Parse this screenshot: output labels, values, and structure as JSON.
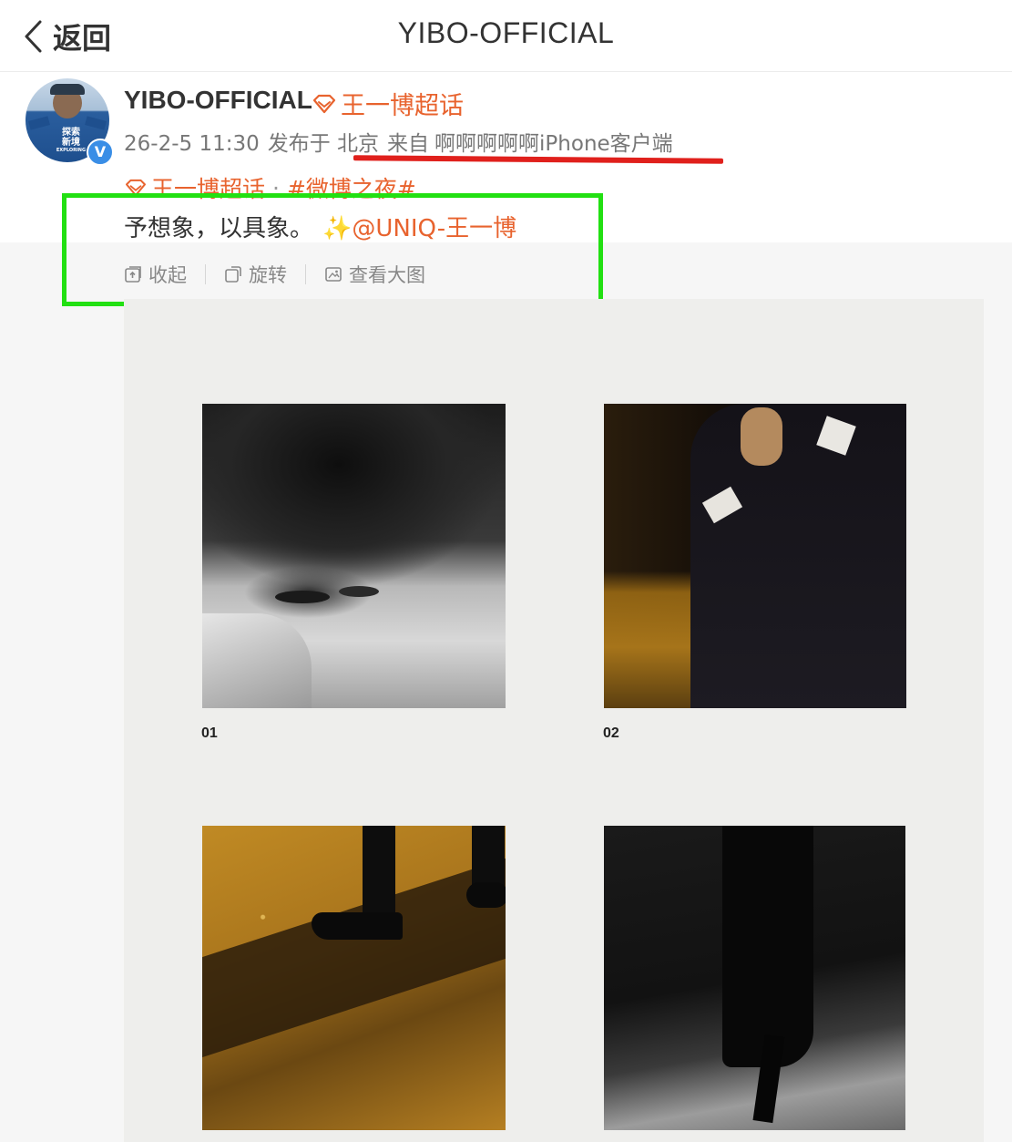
{
  "nav": {
    "back_label": "返回",
    "title": "YIBO-OFFICIAL"
  },
  "author": {
    "name": "YIBO-OFFICIAL",
    "supertopic": "王一博超话",
    "avatar_text": "探索\n新境",
    "avatar_subtext": "EXPLORING",
    "verified_mark": "V",
    "time": "26-2-5 11:30",
    "location": "发布于 北京",
    "source_prefix": "来自",
    "source": "啊啊啊啊啊iPhone客户端"
  },
  "topic_line": {
    "supertopic": "王一博超话",
    "separator": "·",
    "hashtag": "#微博之夜#"
  },
  "post": {
    "text": "予想象，以具象。",
    "sparkle": "✨",
    "mention": "@UNIQ-王一博"
  },
  "actions": {
    "collapse": "收起",
    "rotate": "旋转",
    "view_large": "查看大图"
  },
  "gallery": {
    "captions": [
      "01",
      "02"
    ]
  },
  "colors": {
    "accent_orange": "#e8632e",
    "highlight_box": "#22e012",
    "underline_red": "#e0201c",
    "verified_blue": "#3a8ee6"
  },
  "icons": [
    "chevron-left-icon",
    "supertopic-gem-icon",
    "collapse-icon",
    "rotate-icon",
    "view-large-icon"
  ]
}
